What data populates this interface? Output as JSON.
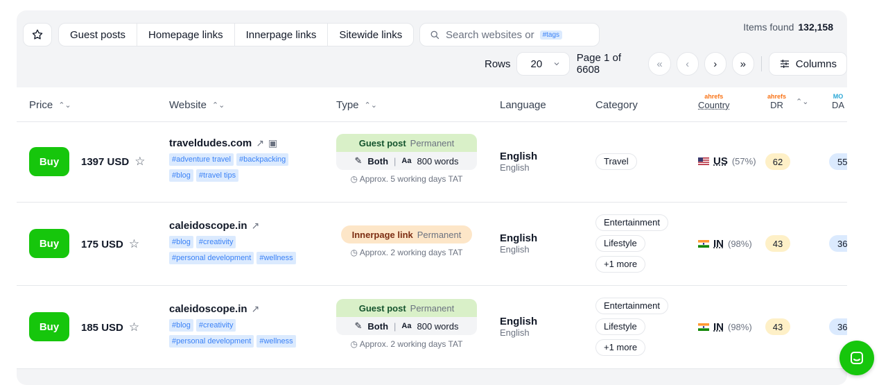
{
  "toolbar": {
    "filters": [
      "Guest posts",
      "Homepage links",
      "Innerpage links",
      "Sitewide links"
    ],
    "search_placeholder": "Search websites or",
    "search_tag": "#tags",
    "items_found_label": "Items found",
    "items_found_count": "132,158",
    "rows_label": "Rows",
    "rows_value": "20",
    "page_label": "Page 1 of 6608",
    "first": "«",
    "prev": "‹",
    "next": "›",
    "last": "»",
    "columns_label": "Columns"
  },
  "header": {
    "price": "Price",
    "website": "Website",
    "type": "Type",
    "language": "Language",
    "category": "Category",
    "ahrefs_brand": "ahrefs",
    "country": "Country",
    "dr": "DR",
    "da": "DA",
    "moz_brand": "MO"
  },
  "rows": [
    {
      "buy": "Buy",
      "price": "1397 USD",
      "website": "traveldudes.com",
      "tags": [
        "#adventure travel",
        "#backpacking",
        "#blog",
        "#travel tips"
      ],
      "type_name": "Guest post",
      "type_term": "Permanent",
      "link_type": "Both",
      "words": "800 words",
      "tat": "Approx. 5 working days TAT",
      "language": "English",
      "language_sub": "English",
      "categories": [
        "Travel"
      ],
      "country_code": "US",
      "country_pct": "(57%)",
      "dr": "62",
      "da": "55"
    },
    {
      "buy": "Buy",
      "price": "175 USD",
      "website": "caleidoscope.in",
      "tags": [
        "#blog",
        "#creativity",
        "#personal development",
        "#wellness"
      ],
      "type_name": "Innerpage link",
      "type_term": "Permanent",
      "tat": "Approx. 2 working days TAT",
      "language": "English",
      "language_sub": "English",
      "categories": [
        "Entertainment",
        "Lifestyle",
        "+1 more"
      ],
      "country_code": "IN",
      "country_pct": "(98%)",
      "dr": "43",
      "da": "36"
    },
    {
      "buy": "Buy",
      "price": "185 USD",
      "website": "caleidoscope.in",
      "tags": [
        "#blog",
        "#creativity",
        "#personal development",
        "#wellness"
      ],
      "type_name": "Guest post",
      "type_term": "Permanent",
      "link_type": "Both",
      "words": "800 words",
      "tat": "Approx. 2 working days TAT",
      "language": "English",
      "language_sub": "English",
      "categories": [
        "Entertainment",
        "Lifestyle",
        "+1 more"
      ],
      "country_code": "IN",
      "country_pct": "(98%)",
      "dr": "43",
      "da": "36"
    }
  ],
  "colors": {
    "buy": "#16c60c",
    "tag_bg": "#dbeafe",
    "tag_text": "#3b82f6",
    "dr_bg": "#fef0c7",
    "da_bg": "#dbeafe"
  }
}
